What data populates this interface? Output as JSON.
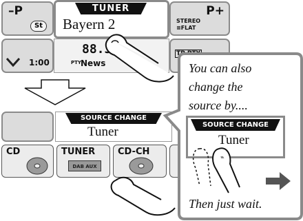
{
  "top_screen": {
    "preset_down_label": "–P",
    "st_badge": "St",
    "source_title": "TUNER",
    "station_name": "Bayern 2",
    "preset_up_label": "P+",
    "eq_line1": "STEREO",
    "eq_line2": "≡FLAT",
    "clock": "1:00",
    "frequency": "88.3",
    "pty_tag": "PTY",
    "pty_value": "News",
    "tp_pty_label": "TP PTY"
  },
  "bottom_screen": {
    "source_change_title": "SOURCE CHANGE",
    "current_source": "Tuner",
    "sources": [
      {
        "label": "CD"
      },
      {
        "label": "TUNER",
        "sublabel": "DAB AUX"
      },
      {
        "label": "CD-CH"
      }
    ]
  },
  "callout": {
    "text_lines": [
      "You can also",
      "change the",
      "source by...."
    ],
    "inset_title": "SOURCE CHANGE",
    "inset_source": "Tuner",
    "footer": "Then just wait."
  },
  "icons": [
    "finger-icon",
    "down-arrow-icon",
    "right-arrow-icon",
    "disc-icon",
    "chevron-down-icon"
  ]
}
